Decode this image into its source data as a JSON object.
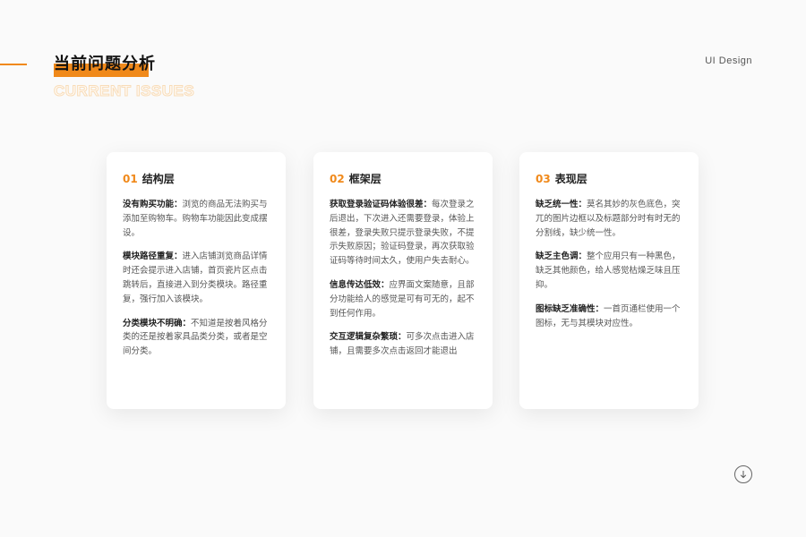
{
  "header": {
    "title": "当前问题分析",
    "subtitle": "CURRENT ISSUES",
    "brand": "UI Design"
  },
  "colors": {
    "accent": "#f0891a"
  },
  "icons": {
    "scroll_down": "arrow-down-circle-icon"
  },
  "cards": [
    {
      "num": "01",
      "title": "结构层",
      "items": [
        {
          "head": "没有购买功能：",
          "text": "浏览的商品无法购买与添加至购物车。购物车功能因此变成摆设。"
        },
        {
          "head": "模块路径重复：",
          "text": "进入店铺浏览商品详情时还会提示进入店铺，首页瓷片区点击跳转后，直接进入到分类模块。路径重复，强行加入该模块。"
        },
        {
          "head": "分类模块不明确：",
          "text": "不知道是按着风格分类的还是按着家具品类分类，或者是空间分类。"
        }
      ]
    },
    {
      "num": "02",
      "title": "框架层",
      "items": [
        {
          "head": "获取登录验证码体验很差：",
          "text": "每次登录之后退出，下次进入还需要登录，体验上很差，登录失败只提示登录失败，不提示失败原因；验证码登录，再次获取验证码等待时间太久，使用户失去耐心。"
        },
        {
          "head": "信息传达低效：",
          "text": "应界面文案随意，且部分功能给人的感觉是可有可无的，起不到任何作用。"
        },
        {
          "head": "交互逻辑复杂繁琐：",
          "text": "可多次点击进入店铺，且需要多次点击返回才能退出"
        }
      ]
    },
    {
      "num": "03",
      "title": "表现层",
      "items": [
        {
          "head": "缺乏统一性：",
          "text": "莫名其妙的灰色底色，突兀的图片边框以及标题部分时有时无的分割线，缺少统一性。"
        },
        {
          "head": "缺乏主色调：",
          "text": "整个应用只有一种黑色，缺乏其他颜色，给人感觉枯燥乏味且压抑。"
        },
        {
          "head": "图标缺乏准确性：",
          "text": "一首页通栏使用一个图标，无与其模块对应性。"
        }
      ]
    }
  ]
}
